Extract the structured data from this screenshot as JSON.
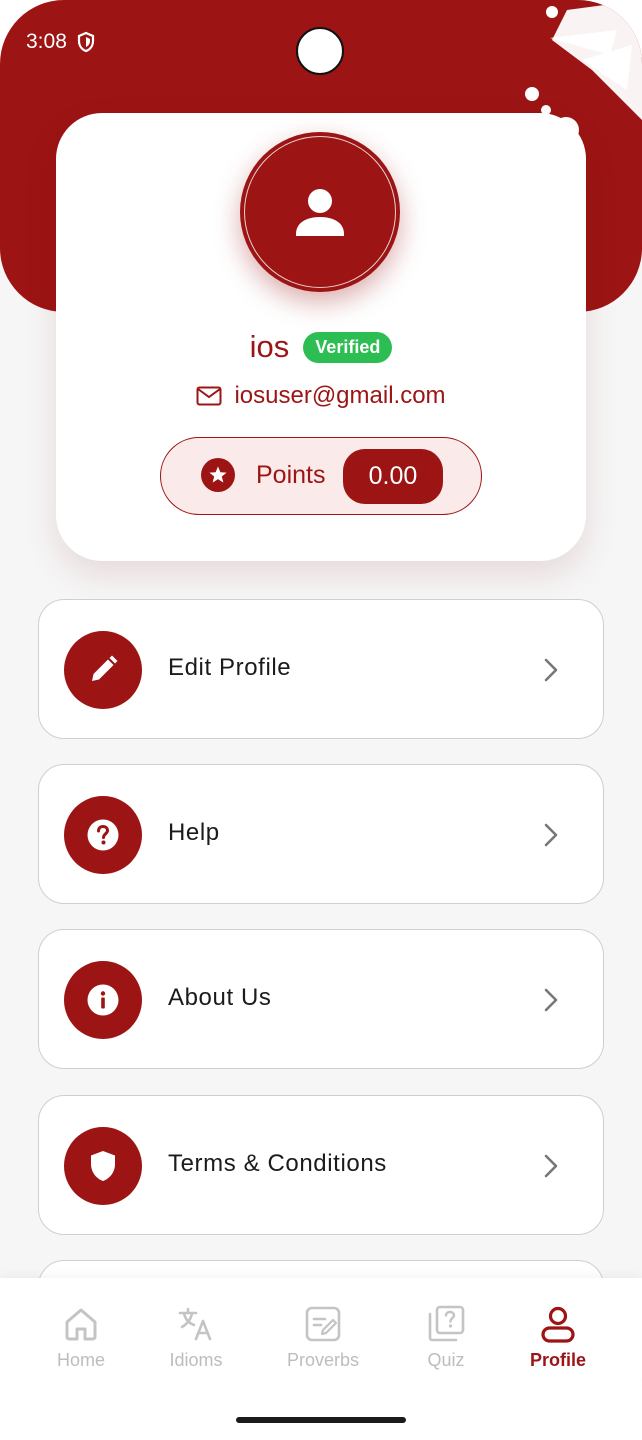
{
  "status_bar": {
    "time": "3:08",
    "icons": [
      "shield-icon"
    ]
  },
  "profile": {
    "name": "ios",
    "verified_badge": "Verified",
    "email": "iosuser@gmail.com",
    "points_label": "Points",
    "points_value": "0.00"
  },
  "menu": [
    {
      "label": "Edit Profile",
      "icon": "pencil-icon"
    },
    {
      "label": "Help",
      "icon": "question-circle-icon"
    },
    {
      "label": "About Us",
      "icon": "info-circle-icon"
    },
    {
      "label": "Terms & Conditions",
      "icon": "shield-icon"
    }
  ],
  "bottom_nav": [
    {
      "label": "Home",
      "icon": "home-icon",
      "active": false
    },
    {
      "label": "Idioms",
      "icon": "translate-icon",
      "active": false
    },
    {
      "label": "Proverbs",
      "icon": "edit-note-icon",
      "active": false
    },
    {
      "label": "Quiz",
      "icon": "quiz-icon",
      "active": false
    },
    {
      "label": "Profile",
      "icon": "user-icon",
      "active": true
    }
  ],
  "colors": {
    "primary": "#9c1414",
    "verified": "#2cbe52",
    "background": "#f6f6f6"
  }
}
